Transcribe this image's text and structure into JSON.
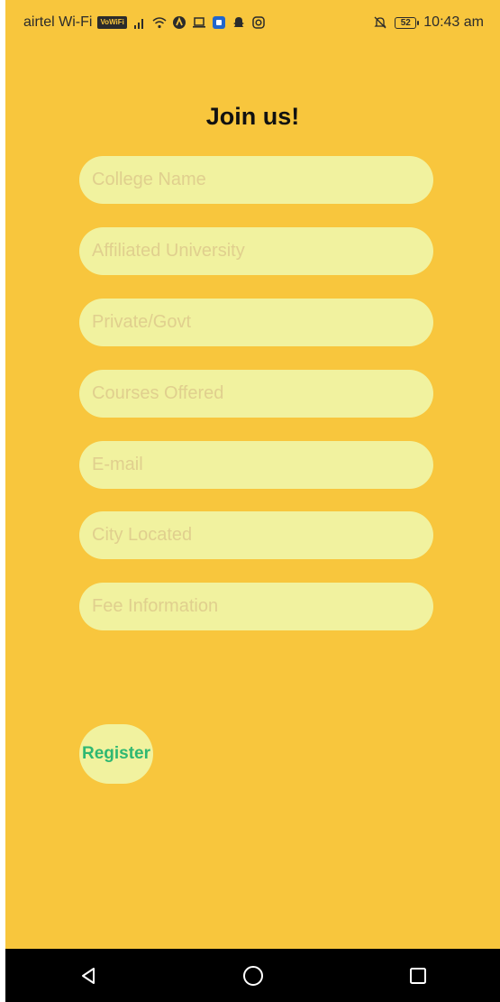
{
  "status_bar": {
    "carrier": "airtel Wi-Fi",
    "volte_badge": "VoWiFi",
    "battery_level": "52",
    "time": "10:43 am",
    "icons": [
      "signal-icon",
      "wifi-icon",
      "notification-app-icon",
      "laptop-icon",
      "shield-app-icon",
      "snapchat-icon",
      "instagram-icon",
      "mute-icon",
      "battery-icon"
    ]
  },
  "form": {
    "title": "Join us!",
    "fields": {
      "college_name": "College Name",
      "affiliated_university": "Affiliated University",
      "private_govt": "Private/Govt",
      "courses_offered": "Courses Offered",
      "email": "E-mail",
      "city_located": "City Located",
      "fee_information": "Fee Information"
    },
    "register_label": "Register"
  },
  "nav_bar": {
    "buttons": [
      "back-icon",
      "home-icon",
      "recents-icon"
    ]
  },
  "colors": {
    "background": "#f8c63d",
    "field_fill": "#f1f29f",
    "placeholder": "#e0cf8e",
    "register_text": "#2eb872",
    "nav_bar": "#000000"
  }
}
